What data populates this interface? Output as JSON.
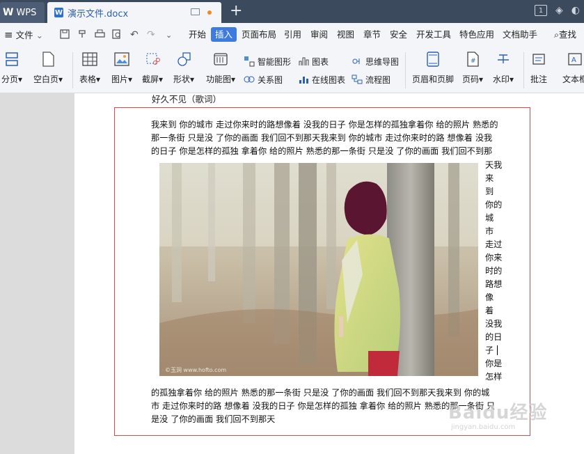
{
  "titlebar": {
    "app_tab": "WPS",
    "doc_tab": "演示文件.docx",
    "new_tab": "+",
    "badge": "1"
  },
  "menu": {
    "file": "文件",
    "items": [
      "开始",
      "插入",
      "页面布局",
      "引用",
      "审阅",
      "视图",
      "章节",
      "安全",
      "开发工具",
      "特色应用",
      "文档助手"
    ],
    "active": "插入",
    "search": "查找"
  },
  "ribbon": {
    "page_break": "分页",
    "blank_page": "空白页",
    "table": "表格",
    "picture": "图片",
    "screenshot": "截屏",
    "shape": "形状",
    "function_chart": "功能图",
    "smart_shape": "智能图形",
    "relation_chart": "关系图",
    "chart": "图表",
    "online_chart": "在线图表",
    "mind_map": "思维导图",
    "flowchart": "流程图",
    "header_footer": "页眉和页脚",
    "page_number": "页码",
    "watermark": "水印",
    "comment": "批注",
    "textbox": "文本框"
  },
  "document": {
    "clipped_title": "好久不见（歌词）",
    "para1": [
      "我来到 你的城市 走过你来时的路想像着 没我的日子 你是怎样的孤独拿着你 给的照片 熟悉的",
      "那一条街  只是没 了你的画面 我们回不到那天我来到 你的城市 走过你来时的路  想像着 没我",
      "的日子 你是怎样的孤独  拿着你 给的照片 熟悉的那一条街  只是没 了你的画面 我们回不到那"
    ],
    "vertical_text": [
      "天我",
      "来",
      "到",
      "你的",
      "城",
      "市",
      "走过",
      "你来",
      "时的",
      "路想",
      "像",
      "着",
      "没我",
      "的日",
      "子",
      "你是",
      "怎样"
    ],
    "para2": [
      "的孤独拿着你 给的照片 熟悉的那一条街  只是没 了你的画面 我们回不到那天我来到 你的城",
      "市 走过你来时的路  想像着 没我的日子 你是怎样的孤独  拿着你 给的照片 熟悉的那一条街  只",
      "是没 了你的画面 我们回不到那天"
    ]
  },
  "watermark": {
    "text": "Baidu经验",
    "sub": "jingyan.baidu.com"
  },
  "colors": {
    "titlebar": "#3c4a5e",
    "accent": "#3d7be0",
    "frame_border": "#e0484c"
  }
}
